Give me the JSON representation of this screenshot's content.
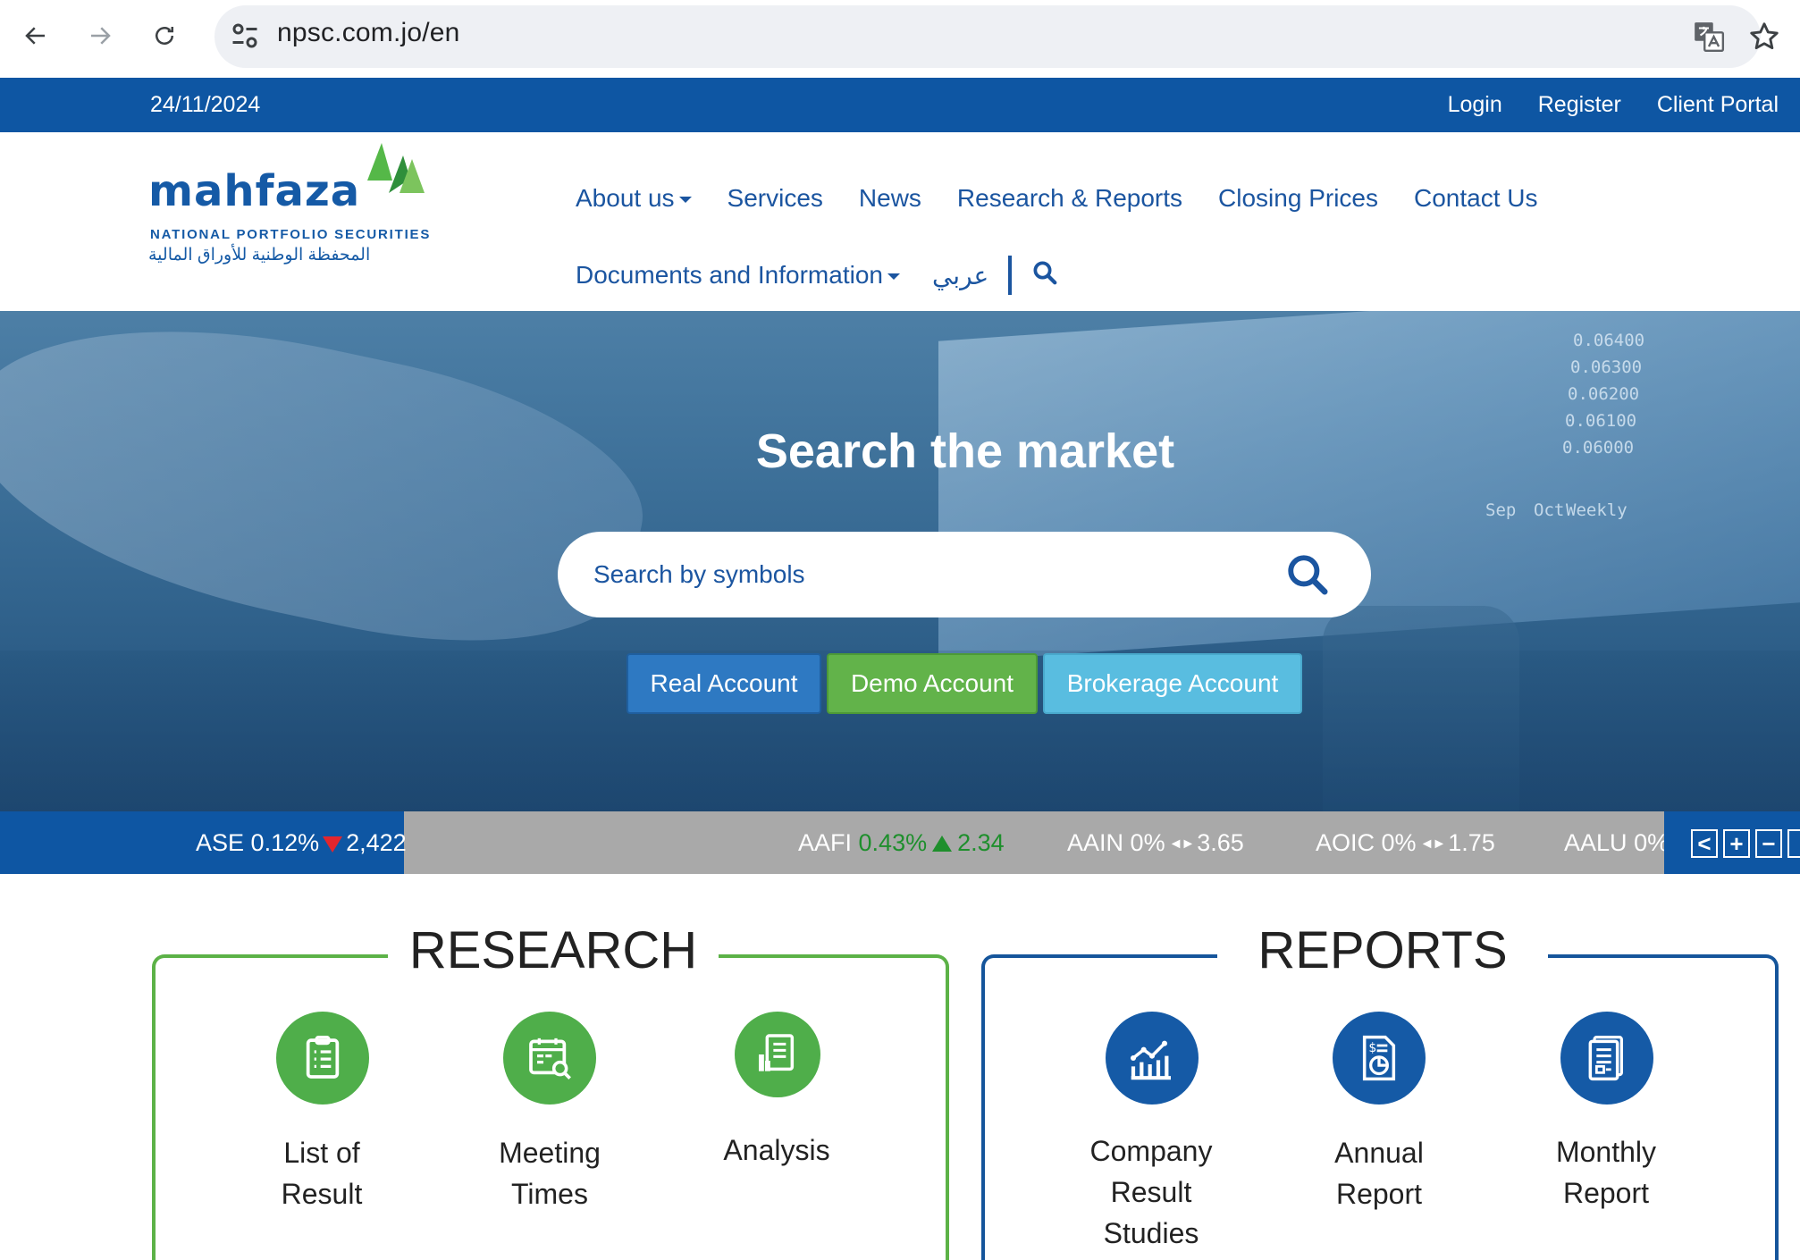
{
  "browser": {
    "url": "npsc.com.jo/en"
  },
  "topbar": {
    "date": "24/11/2024",
    "links": [
      "Login",
      "Register",
      "Client Portal"
    ]
  },
  "logo": {
    "word": "mahfaza",
    "subtitle": "NATIONAL PORTFOLIO SECURITIES",
    "arabic": "المحفظة الوطنية للأوراق المالية"
  },
  "nav": {
    "about": "About us",
    "services": "Services",
    "news": "News",
    "research_reports": "Research & Reports",
    "closing_prices": "Closing Prices",
    "contact": "Contact Us",
    "documents": "Documents and Information",
    "arabic": "عربي"
  },
  "hero": {
    "title": "Search the market",
    "search_placeholder": "Search by symbols",
    "buttons": {
      "real": "Real Account",
      "demo": "Demo Account",
      "brokerage": "Brokerage Account"
    },
    "chart_ticks": [
      "0.06400",
      "0.06300",
      "0.06200",
      "0.06100",
      "0.06000"
    ],
    "chart_axis": [
      "Sep",
      "Oct",
      "Weekly"
    ],
    "colors": {
      "real": "#2e79c2",
      "demo": "#62b34a",
      "brokerage": "#59bde0"
    }
  },
  "ticker": {
    "index": {
      "name": "ASE",
      "change": "0.12%",
      "value": "2,422",
      "direction": "down"
    },
    "items": [
      {
        "symbol": "AAFI",
        "change": "0.43%",
        "value": "2.34",
        "direction": "up"
      },
      {
        "symbol": "AAIN",
        "change": "0%",
        "value": "3.65",
        "direction": "flat"
      },
      {
        "symbol": "AOIC",
        "change": "0%",
        "value": "1.75",
        "direction": "flat"
      },
      {
        "symbol": "AALU",
        "change": "0%",
        "value": "",
        "direction": "flat"
      }
    ],
    "controls": {
      "prev": "<",
      "plus": "+",
      "minus": "−"
    }
  },
  "research": {
    "title": "RESEARCH",
    "items": [
      {
        "line1": "List of",
        "line2": "Result",
        "icon": "clipboard-list-icon"
      },
      {
        "line1": "Meeting",
        "line2": "Times",
        "icon": "calendar-search-icon"
      },
      {
        "line1": "Analysis",
        "icon": "analysis-document-icon"
      }
    ]
  },
  "reports": {
    "title": "REPORTS",
    "items": [
      {
        "line1": "Company",
        "line2": "Result",
        "line3": "Studies",
        "icon": "growth-chart-icon"
      },
      {
        "line1": "Annual",
        "line2": "Report",
        "icon": "financial-report-icon"
      },
      {
        "line1": "Monthly",
        "line2": "Report",
        "icon": "monthly-report-icon"
      }
    ]
  }
}
